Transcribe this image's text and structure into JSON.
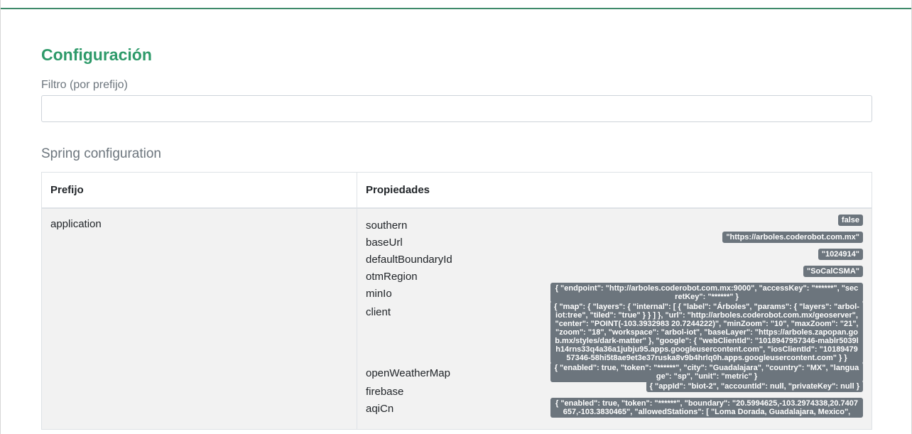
{
  "page": {
    "title": "Configuración",
    "filter_label": "Filtro (por prefijo)",
    "filter_value": "",
    "section_title": "Spring configuration"
  },
  "table": {
    "headers": [
      "Prefijo",
      "Propiedades"
    ],
    "rows": [
      {
        "prefix": "application",
        "properties": [
          {
            "name": "southern",
            "value": "false"
          },
          {
            "name": "baseUrl",
            "value": "\"https://arboles.coderobot.com.mx\""
          },
          {
            "name": "defaultBoundaryId",
            "value": "\"1024914\""
          },
          {
            "name": "otmRegion",
            "value": "\"SoCalCSMA\""
          },
          {
            "name": "minIo",
            "value": "{ \"endpoint\": \"http://arboles.coderobot.com.mx:9000\", \"accessKey\": \"******\", \"secretKey\": \"******\" }"
          },
          {
            "name": "client",
            "value": "{ \"map\": { \"layers\": { \"internal\": [ { \"label\": \"Árboles\", \"params\": { \"layers\": \"arbol-iot:tree\", \"tiled\": \"true\" } } ] }, \"url\": \"http://arboles.coderobot.com.mx/geoserver\", \"center\": \"POINT(-103.3932983 20.7244222)\", \"minZoom\": \"10\", \"maxZoom\": \"21\", \"zoom\": \"18\", \"workspace\": \"arbol-iot\", \"baseLayer\": \"https://arboles.zapopan.gob.mx/styles/dark-matter\" }, \"google\": { \"webClientId\": \"1018947957346-mablr5039lh14rns33q4a36a1jubju95.apps.googleusercontent.com\", \"iosClientId\": \"1018947957346-58hi5t8ae9et3e37ruska8v9b4hrlq0h.apps.googleusercontent.com\" } }"
          },
          {
            "name": "openWeatherMap",
            "value": "{ \"enabled\": true, \"token\": \"******\", \"city\": \"Guadalajara\", \"country\": \"MX\", \"language\": \"sp\", \"unit\": \"metric\" }"
          },
          {
            "name": "firebase",
            "value": "{ \"appId\": \"biot-2\", \"accountId\": null, \"privateKey\": null }"
          },
          {
            "name": "aqiCn",
            "value": "{ \"enabled\": true, \"token\": \"******\", \"boundary\": \"20.5994625,-103.2974338,20.7407657,-103.3830465\", \"allowedStations\": [ \"Loma Dorada, Guadalajara, Mexico\","
          }
        ]
      }
    ]
  }
}
